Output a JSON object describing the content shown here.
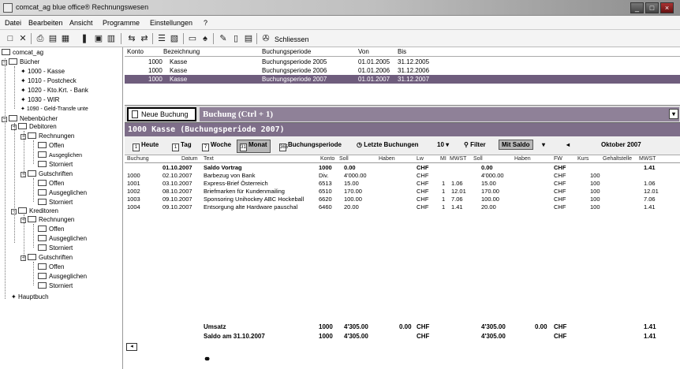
{
  "window": {
    "title": "comcat_ag   blue office® Rechnungswesen",
    "minimize": "_",
    "maximize": "□",
    "close": "×"
  },
  "menu": [
    "Datei",
    "Bearbeiten",
    "Ansicht",
    "Programme",
    "Einstellungen",
    "?"
  ],
  "toolbar": {
    "close_label": "Schliessen"
  },
  "tree": {
    "root": "comcat_ag",
    "buecher": "Bücher",
    "accounts": [
      "1000 - Kasse",
      "1010 - Postcheck",
      "1020 - Kto.Krt. - Bank",
      "1030 - WIR",
      "1090 - Geld-Transfe unte"
    ],
    "nebenbuecher": "Nebenbücher",
    "debitoren": "Debitoren",
    "rechnungen": "Rechnungen",
    "offen": "Offen",
    "ausgeglichen": "Ausgeglichen",
    "storniert": "Storniert",
    "gutschriften": "Gutschriften",
    "kreditoren": "Kreditoren",
    "hauptbuch": "Hauptbuch"
  },
  "periods": {
    "headers": [
      "Konto",
      "Bezeichnung",
      "Buchungsperiode",
      "Von",
      "Bis"
    ],
    "rows": [
      [
        "1000",
        "Kasse",
        "Buchungsperiode 2005",
        "01.01.2005",
        "31.12.2005"
      ],
      [
        "1000",
        "Kasse",
        "Buchungsperiode 2006",
        "01.01.2006",
        "31.12.2006"
      ],
      [
        "1000",
        "Kasse",
        "Buchungsperiode 2007",
        "01.01.2007",
        "31.12.2007"
      ]
    ]
  },
  "actions": {
    "new_booking": "Neue Buchung",
    "booking_header": "Buchung (Ctrl + 1)",
    "dropdown": "▾"
  },
  "account_bar": "1000  Kasse (Buchungsperiode 2007)",
  "filters": {
    "heute": "Heute",
    "tag": "Tag",
    "woche": "Woche",
    "monat": "Monat",
    "buchungsperiode": "Buchungsperiode",
    "letzte": "Letzte Buchungen",
    "count": "10",
    "filter": "Filter",
    "mitsaldo": "Mit Saldo",
    "month": "Oktober 2007",
    "icon_heute": "1",
    "icon_tag": "1",
    "icon_woche": "7",
    "icon_monat": "31",
    "icon_periode": "365"
  },
  "grid": {
    "headers": [
      "Buchung",
      "Datum",
      "Text",
      "Konto",
      "Soll",
      "Haben",
      "Lw",
      "MI",
      "MWST",
      "Soll",
      "Haben",
      "FW",
      "Kurs",
      "Gehaltstelle",
      "MWST"
    ],
    "rows": [
      {
        "nr": "",
        "datum": "01.10.2007",
        "text": "Saldo Vortrag",
        "konto": "1000",
        "soll": "0.00",
        "haben": "",
        "lw": "CHF",
        "mi": "",
        "mwst": "",
        "soll2": "0.00",
        "haben2": "",
        "fw": "CHF",
        "kurs": "",
        "saldo": "1.41",
        "bold": true
      },
      {
        "nr": "1000",
        "datum": "02.10.2007",
        "text": "Barbezug von Bank",
        "konto": "Div.",
        "soll": "4'000.00",
        "haben": "",
        "lw": "CHF",
        "mi": "",
        "mwst": "",
        "soll2": "4'000.00",
        "haben2": "",
        "fw": "CHF",
        "kurs": "100",
        "saldo": "",
        "bold": false
      },
      {
        "nr": "1001",
        "datum": "03.10.2007",
        "text": "Express-Brief Österreich",
        "konto": "6513",
        "soll": "15.00",
        "haben": "",
        "lw": "CHF",
        "mi": "1",
        "mwst": "1.06",
        "soll2": "15.00",
        "haben2": "",
        "fw": "CHF",
        "kurs": "100",
        "saldo": "1.06",
        "bold": false
      },
      {
        "nr": "1002",
        "datum": "08.10.2007",
        "text": "Briefmarken für Kundenmailing",
        "konto": "6510",
        "soll": "170.00",
        "haben": "",
        "lw": "CHF",
        "mi": "1",
        "mwst": "12.01",
        "soll2": "170.00",
        "haben2": "",
        "fw": "CHF",
        "kurs": "100",
        "saldo": "12.01",
        "bold": false
      },
      {
        "nr": "1003",
        "datum": "09.10.2007",
        "text": "Sponsoring Unihockey ABC Hockeball",
        "konto": "6620",
        "soll": "100.00",
        "haben": "",
        "lw": "CHF",
        "mi": "1",
        "mwst": "7.06",
        "soll2": "100.00",
        "haben2": "",
        "fw": "CHF",
        "kurs": "100",
        "saldo": "7.06",
        "bold": false
      },
      {
        "nr": "1004",
        "datum": "09.10.2007",
        "text": "Entsorgung alte Hardware pauschal",
        "konto": "6460",
        "soll": "20.00",
        "haben": "",
        "lw": "CHF",
        "mi": "1",
        "mwst": "1.41",
        "soll2": "20.00",
        "haben2": "",
        "fw": "CHF",
        "kurs": "100",
        "saldo": "1.41",
        "bold": false
      }
    ],
    "footer": {
      "umsatz_label": "Umsatz",
      "umsatz_konto": "1000",
      "umsatz_soll": "4'305.00",
      "umsatz_haben": "0.00",
      "umsatz_lw": "CHF",
      "umsatz_soll2": "4'305.00",
      "umsatz_haben2": "0.00",
      "umsatz_fw": "CHF",
      "umsatz_saldo": "1.41",
      "saldo_label": "Saldo am 31.10.2007",
      "saldo_konto": "1000",
      "saldo_soll": "4'305.00",
      "saldo_lw": "CHF",
      "saldo_soll2": "4'305.00",
      "saldo_fw": "CHF",
      "saldo_saldo": "1.41"
    }
  }
}
